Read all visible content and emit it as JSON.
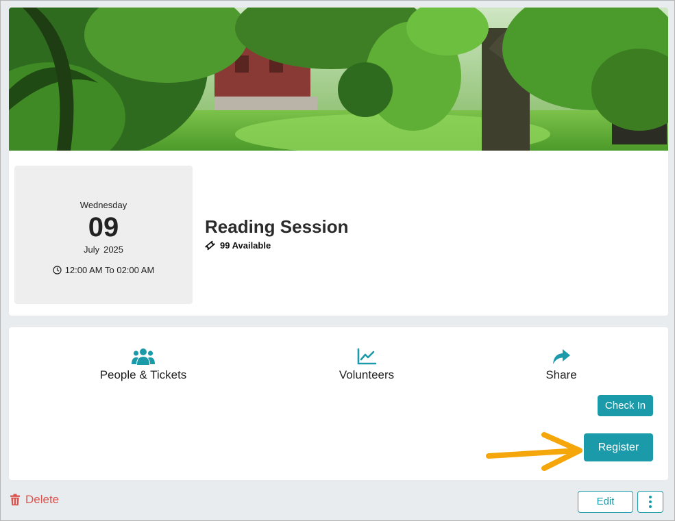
{
  "event": {
    "weekday": "Wednesday",
    "day": "09",
    "month": "July",
    "year": "2025",
    "time": "12:00 AM To 02:00 AM",
    "title": "Reading Session",
    "availability": "99 Available"
  },
  "actions": {
    "people_tickets": "People & Tickets",
    "volunteers": "Volunteers",
    "share": "Share",
    "check_in": "Check In",
    "register": "Register"
  },
  "footer": {
    "delete": "Delete",
    "edit": "Edit"
  },
  "icons": {
    "people": "users-icon",
    "volunteers": "chart-line-icon",
    "share": "share-icon",
    "ticket": "ticket-icon",
    "clock": "clock-icon",
    "trash": "trash-icon",
    "more": "ellipsis-vertical-icon"
  },
  "colors": {
    "accent": "#1b9aaa",
    "danger": "#d9534f",
    "annotation_arrow": "#f5a60a"
  }
}
